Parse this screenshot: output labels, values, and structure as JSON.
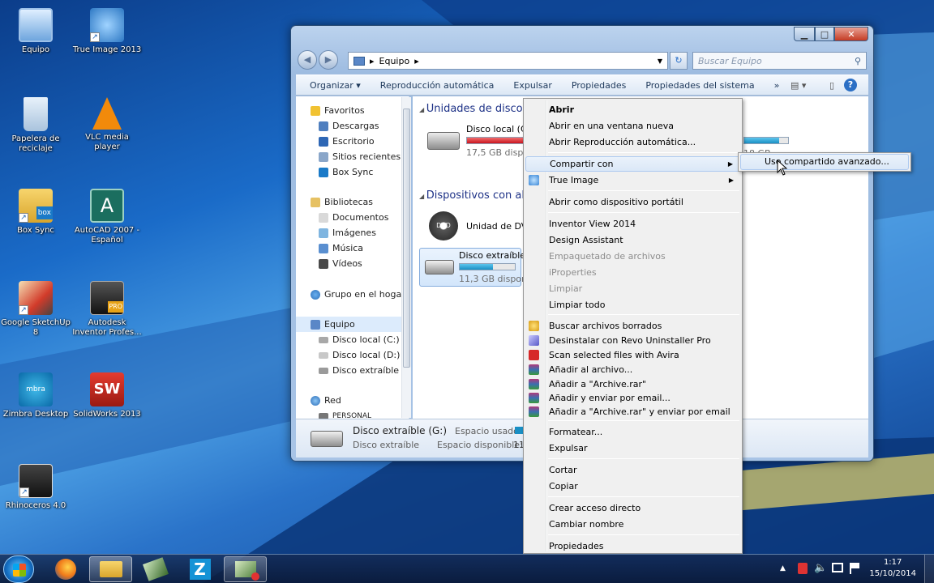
{
  "desktop_icons": [
    {
      "id": "equipo",
      "label": "Equipo"
    },
    {
      "id": "trueimage",
      "label": "True Image 2013"
    },
    {
      "id": "recycle",
      "label": "Papelera de reciclaje"
    },
    {
      "id": "vlc",
      "label": "VLC media player"
    },
    {
      "id": "boxsync",
      "label": "Box Sync"
    },
    {
      "id": "autocad",
      "label": "AutoCAD 2007 - Español"
    },
    {
      "id": "sketchup",
      "label": "Google SketchUp 8"
    },
    {
      "id": "inventor",
      "label": "Autodesk Inventor Profes..."
    },
    {
      "id": "zimbra",
      "label": "Zimbra Desktop"
    },
    {
      "id": "solidworks",
      "label": "SolidWorks 2013"
    },
    {
      "id": "rhino",
      "label": "Rhinoceros 4.0"
    }
  ],
  "explorer": {
    "address": "Equipo",
    "search_placeholder": "Buscar Equipo",
    "toolbar": [
      "Organizar ▾",
      "Reproducción automática",
      "Expulsar",
      "Propiedades",
      "Propiedades del sistema",
      "»"
    ],
    "nav": {
      "favoritos": "Favoritos",
      "descargas": "Descargas",
      "escritorio": "Escritorio",
      "sitios": "Sitios recientes",
      "boxsync": "Box Sync",
      "bibliotecas": "Bibliotecas",
      "documentos": "Documentos",
      "imagenes": "Imágenes",
      "musica": "Música",
      "videos": "Vídeos",
      "grupo": "Grupo en el hogar",
      "equipo": "Equipo",
      "disco_c": "Disco local (C:)",
      "disco_d": "Disco local (D:)",
      "disco_g": "Disco extraíble (G",
      "red": "Red",
      "personal": "PERSONAL"
    },
    "content": {
      "group1": "Unidades de disco d",
      "drive_c_name": "Disco local (C:)",
      "drive_c_free": "17,5 GB dispon",
      "drive_c_fill": 0.94,
      "drive_d_free": "18 GB",
      "drive_d_fill": 0.8,
      "group2": "Dispositivos con alr",
      "dvd_name": "Unidad de DVD",
      "dvd_badge": "DVD",
      "usb_name": "Disco extraíble",
      "usb_free": "11,3 GB dispon",
      "usb_fill": 0.6
    },
    "details": {
      "name": "Disco extraíble (G:)",
      "type": "Disco extraíble",
      "used_label": "Espacio usado:",
      "free_label": "Espacio disponible:",
      "free_value": "11"
    }
  },
  "context_menu": {
    "items": [
      "Abrir",
      "Abrir en una ventana nueva",
      "Abrir Reproducción automática...",
      "Compartir con",
      "True Image",
      "Abrir como dispositivo portátil",
      "Inventor View 2014",
      "Design Assistant",
      "Empaquetado de archivos",
      "iProperties",
      "Limpiar",
      "Limpiar todo",
      "Buscar archivos borrados",
      "Desinstalar con Revo Uninstaller Pro",
      "Scan selected files with Avira",
      "Añadir al archivo...",
      "Añadir a \"Archive.rar\"",
      "Añadir y enviar por email...",
      "Añadir a \"Archive.rar\" y enviar por email",
      "Formatear...",
      "Expulsar",
      "Cortar",
      "Copiar",
      "Crear acceso directo",
      "Cambiar nombre",
      "Propiedades"
    ],
    "submenu_item": "Uso compartido avanzado..."
  },
  "taskbar": {
    "time": "1:17",
    "date": "15/10/2014",
    "zimbra_letter": "Z"
  },
  "colors": {
    "accent": "#1a66c8",
    "bar_red": "#d9232e",
    "bar_blue": "#2aa0d8",
    "highlight": "#dbe8f7"
  }
}
